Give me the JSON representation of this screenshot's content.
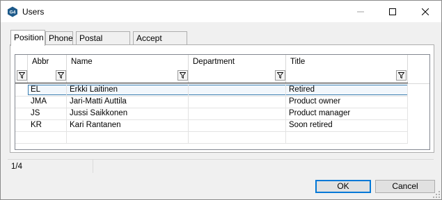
{
  "window": {
    "title": "Users",
    "app_icon_text": "G4"
  },
  "tabs": [
    {
      "label": "Position",
      "active": true
    },
    {
      "label": "Phone",
      "active": false
    },
    {
      "label": "Postal Address",
      "active": false
    },
    {
      "label": "Accept Rights",
      "active": false
    }
  ],
  "grid": {
    "columns": [
      "Abbr",
      "Name",
      "Department",
      "Title"
    ],
    "rows": [
      {
        "abbr": "EL",
        "name": "Erkki Laitinen",
        "department": "",
        "title": "Retired",
        "selected": true
      },
      {
        "abbr": "JMA",
        "name": "Jari-Matti Auttila",
        "department": "",
        "title": "Product owner"
      },
      {
        "abbr": "JS",
        "name": "Jussi Saikkonen",
        "department": "",
        "title": "Product manager"
      },
      {
        "abbr": "KR",
        "name": "Kari Rantanen",
        "department": "",
        "title": "Soon retired"
      }
    ]
  },
  "status": {
    "record_count": "1/4"
  },
  "buttons": {
    "ok": "OK",
    "cancel": "Cancel"
  },
  "colors": {
    "accent": "#0078d7",
    "selection_border": "#3c7fb1",
    "app_icon": "#1e5a8a"
  }
}
